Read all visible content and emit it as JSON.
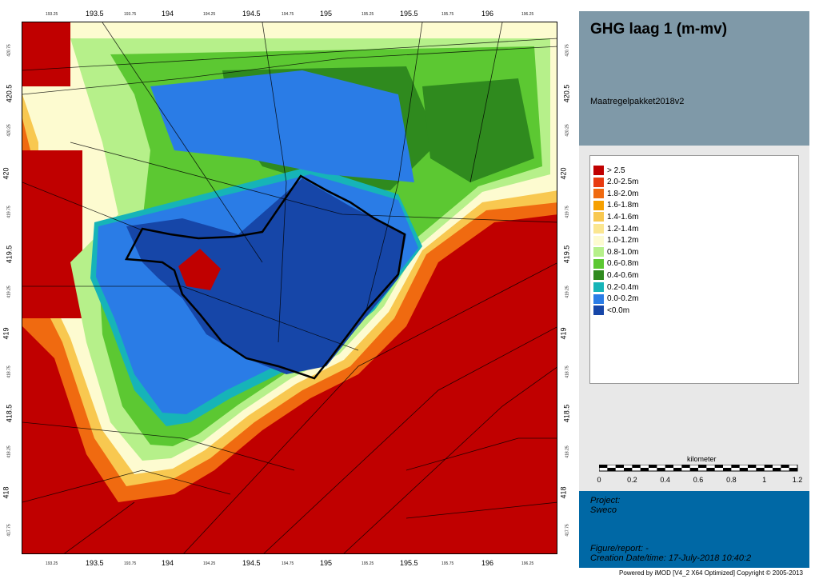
{
  "title": "GHG laag 1 (m-mv)",
  "subtitle": "Maatregelpakket2018v2",
  "legend": [
    {
      "label": "> 2.5",
      "color": "#c00000"
    },
    {
      "label": "2.0-2.5m",
      "color": "#e83a10"
    },
    {
      "label": "1.8-2.0m",
      "color": "#f06a10"
    },
    {
      "label": "1.6-1.8m",
      "color": "#f6a000"
    },
    {
      "label": "1.4-1.6m",
      "color": "#f8c850"
    },
    {
      "label": "1.2-1.4m",
      "color": "#fbe690"
    },
    {
      "label": "1.0-1.2m",
      "color": "#fdfbd0"
    },
    {
      "label": "0.8-1.0m",
      "color": "#b6f08a"
    },
    {
      "label": "0.6-0.8m",
      "color": "#5cc832"
    },
    {
      "label": "0.4-0.6m",
      "color": "#2f8a1e"
    },
    {
      "label": "0.2-0.4m",
      "color": "#16b4b8"
    },
    {
      "label": "0.0-0.2m",
      "color": "#2a7ce6"
    },
    {
      "label": "<0.0m",
      "color": "#1646a8"
    }
  ],
  "scale": {
    "unit": "kilometer",
    "labels": [
      "0",
      "0.2",
      "0.4",
      "0.6",
      "0.8",
      "1",
      "1.2"
    ]
  },
  "axes": {
    "x_major": [
      "193.5",
      "194",
      "194.5",
      "195",
      "195.5",
      "196"
    ],
    "x_minor": [
      "193.25",
      "193.75",
      "194.25",
      "194.75",
      "195.25",
      "195.75",
      "196.25"
    ],
    "y_major": [
      "420.5",
      "420",
      "419.5",
      "419",
      "418.5",
      "418"
    ],
    "y_minor": [
      "420.75",
      "420.25",
      "419.75",
      "419.25",
      "418.75",
      "418.25",
      "417.75"
    ]
  },
  "project": {
    "project_label": "Project:",
    "project_name": "Sweco",
    "figure_label": "Figure/report: -",
    "creation": "Creation Date/time: 17-July-2018 10:40:2"
  },
  "footer": "Powered by iMOD [V4_2 X64 Optimized] Copyright © 2005-2013"
}
